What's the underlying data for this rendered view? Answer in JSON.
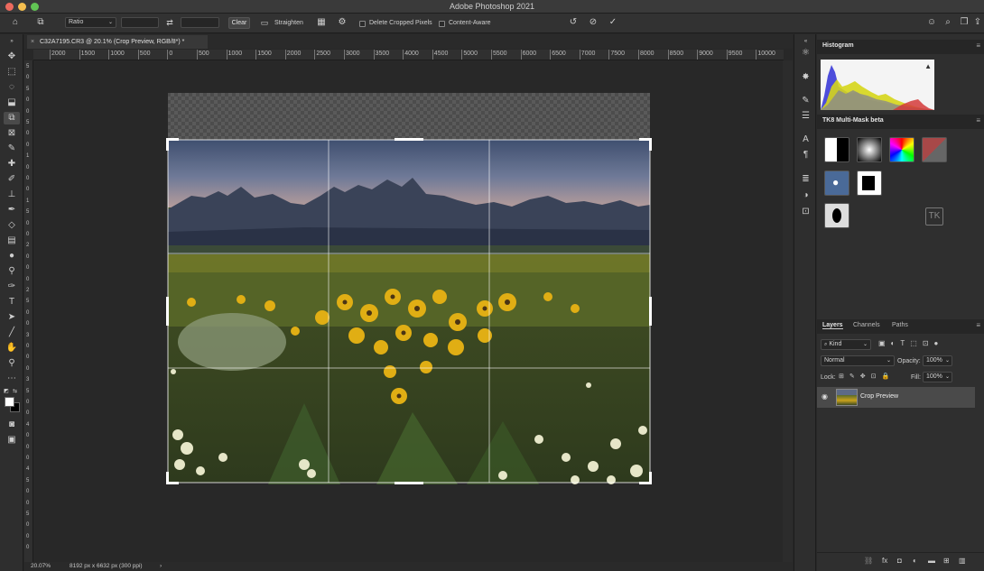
{
  "window": {
    "title": "Adobe Photoshop 2021"
  },
  "options_bar": {
    "ratio_label": "Ratio",
    "clear_label": "Clear",
    "straighten_label": "Straighten",
    "delete_cropped_label": "Delete Cropped Pixels",
    "content_aware_label": "Content-Aware"
  },
  "document": {
    "tab_title": "C32A7195.CR3 @ 20.1% (Crop Preview, RGB/8*) *",
    "zoom": "20.07%",
    "info": "8192 px x 6632 px (300 ppi)"
  },
  "ruler": {
    "top_ticks": [
      "2000",
      "1500",
      "1000",
      "500",
      "0",
      "500",
      "1000",
      "1500",
      "2000",
      "2500",
      "3000",
      "3500",
      "4000",
      "4500",
      "5000",
      "5500",
      "6000",
      "6500",
      "7000",
      "7500",
      "8000",
      "8500",
      "9000",
      "9500",
      "10000"
    ],
    "left_ticks": [
      "5",
      "0",
      "5",
      "0",
      "0",
      "5",
      "0",
      "0",
      "1",
      "0",
      "0",
      "0",
      "1",
      "5",
      "0",
      "0",
      "2",
      "0",
      "0",
      "0",
      "2",
      "5",
      "0",
      "0",
      "3",
      "0",
      "0",
      "0",
      "3",
      "5",
      "0",
      "0",
      "4",
      "0",
      "0",
      "0",
      "4",
      "5",
      "0",
      "0",
      "5",
      "0",
      "0",
      "0"
    ]
  },
  "panels": {
    "histogram": {
      "title": "Histogram"
    },
    "multimask": {
      "title": "TK8 Multi-Mask beta"
    },
    "layers": {
      "tabs": [
        "Layers",
        "Channels",
        "Paths"
      ],
      "kind_label": "Kind",
      "blend_mode": "Normal",
      "opacity_label": "Opacity:",
      "opacity_value": "100%",
      "lock_label": "Lock:",
      "fill_label": "Fill:",
      "fill_value": "100%",
      "layer_name": "Crop Preview"
    }
  },
  "colors": {
    "bg": "#282828",
    "panel": "#2f2f2f",
    "close": "#ed6a5e",
    "minimize": "#f5bf4f",
    "maximize": "#61c454"
  }
}
